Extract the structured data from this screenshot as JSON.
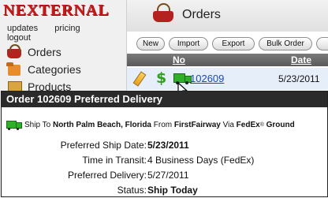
{
  "brand": {
    "logo_text": "NEXTERNAL"
  },
  "top_links": [
    "updates",
    "pricing",
    "logout"
  ],
  "nav": [
    {
      "label": "Orders",
      "icon": "basket-icon"
    },
    {
      "label": "Categories",
      "icon": "categories-icon"
    },
    {
      "label": "Products",
      "icon": "products-icon"
    }
  ],
  "header": {
    "title": "Orders",
    "icon": "basket-icon"
  },
  "toolbar": {
    "buttons": [
      "New",
      "Import",
      "Export",
      "Bulk Order"
    ]
  },
  "table": {
    "columns": [
      "No",
      "Date"
    ],
    "rows": [
      {
        "order_no": "102609",
        "date": "5/23/2011"
      }
    ]
  },
  "popup": {
    "title": "Order 102609 Preferred Delivery",
    "ship": {
      "prefix": "Ship To",
      "destination": "North Palm Beach, Florida",
      "from_label": "From",
      "origin": "FirstFairway",
      "via_label": "Via",
      "carrier": "FedEx",
      "reg_mark": "®",
      "service": "Ground"
    },
    "details": [
      {
        "label": "Preferred Ship Date:",
        "value": "5/23/2011",
        "bold": true
      },
      {
        "label": "Time in Transit:",
        "value": "4 Business Days (FedEx)",
        "bold": false
      },
      {
        "label": "Preferred Delivery:",
        "value": "5/27/2011",
        "bold": false
      },
      {
        "label": "Status:",
        "value": "Ship Today",
        "bold": true
      }
    ]
  },
  "colors": {
    "brand_red": "#c41b18",
    "link_blue": "#1a4bb5",
    "truck_green": "#30b02a",
    "header_gray": "#5a5a5a"
  }
}
